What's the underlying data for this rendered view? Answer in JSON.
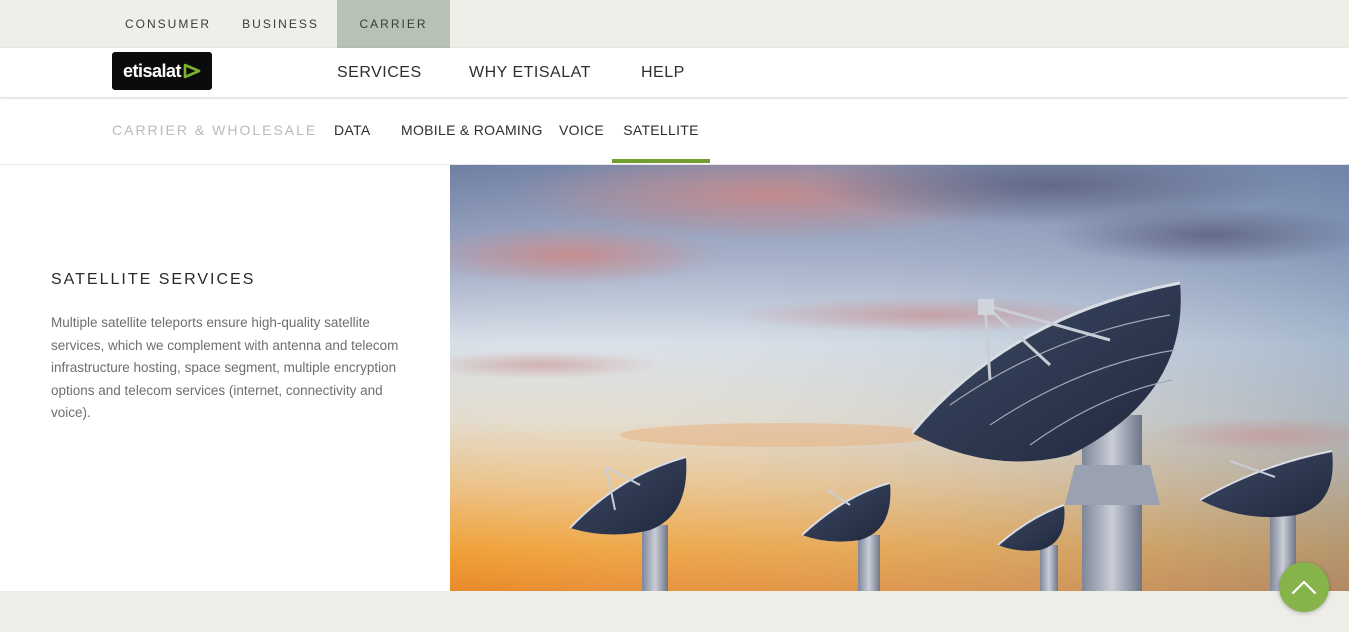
{
  "audience_bar": {
    "items": [
      {
        "label": "CONSUMER",
        "active": false
      },
      {
        "label": "BUSINESS",
        "active": false
      },
      {
        "label": "CARRIER",
        "active": true
      }
    ],
    "active_color": "#b6c2b4"
  },
  "brand": {
    "logo_text": "etisalat",
    "logo_icon": "etisalat-logo-icon",
    "accent_color": "#7ab32e"
  },
  "main_nav": {
    "items": [
      {
        "label": "SERVICES"
      },
      {
        "label": "WHY ETISALAT"
      },
      {
        "label": "HELP"
      }
    ]
  },
  "sub_nav": {
    "section_label": "CARRIER & WHOLESALE",
    "items": [
      {
        "label": "DATA",
        "active": false
      },
      {
        "label": "MOBILE & ROAMING",
        "active": false
      },
      {
        "label": "VOICE",
        "active": false
      },
      {
        "label": "SATELLITE",
        "active": true
      }
    ],
    "active_underline_color": "#719e2f"
  },
  "content": {
    "title": "SATELLITE SERVICES",
    "body": "Multiple satellite teleports ensure high-quality satellite services, which we complement with antenna and telecom infrastructure hosting, space segment, multiple encryption options and telecom services (internet, connectivity and voice)."
  },
  "hero_image": {
    "subject": "satellite dishes at sunset"
  },
  "scroll_to_top": {
    "icon": "chevron-up-icon",
    "color": "#86b34a"
  }
}
